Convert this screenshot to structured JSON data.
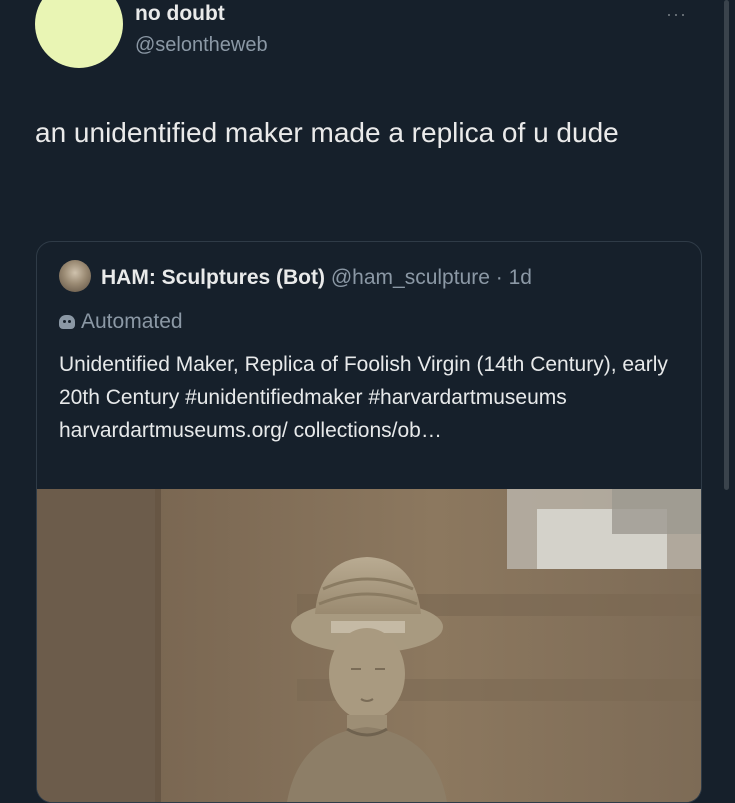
{
  "tweet": {
    "author_name": "no doubt",
    "author_handle": "@selontheweb",
    "more": "···",
    "text": "an unidentified maker made a replica of u dude"
  },
  "quoted": {
    "author_name": "HAM: Sculptures (Bot)",
    "meta": "@ham_sculpture · 1d",
    "automated_label": "Automated",
    "text": "Unidentified Maker, Replica of Foolish Virgin (14th Century), early 20th Century #unidentifiedmaker #harvardartmuseums harvardartmuseums.org/ collections/ob…"
  },
  "colors": {
    "background": "#16202b",
    "avatar": "#e9f5b4",
    "secondary_text": "#8b98a5"
  }
}
